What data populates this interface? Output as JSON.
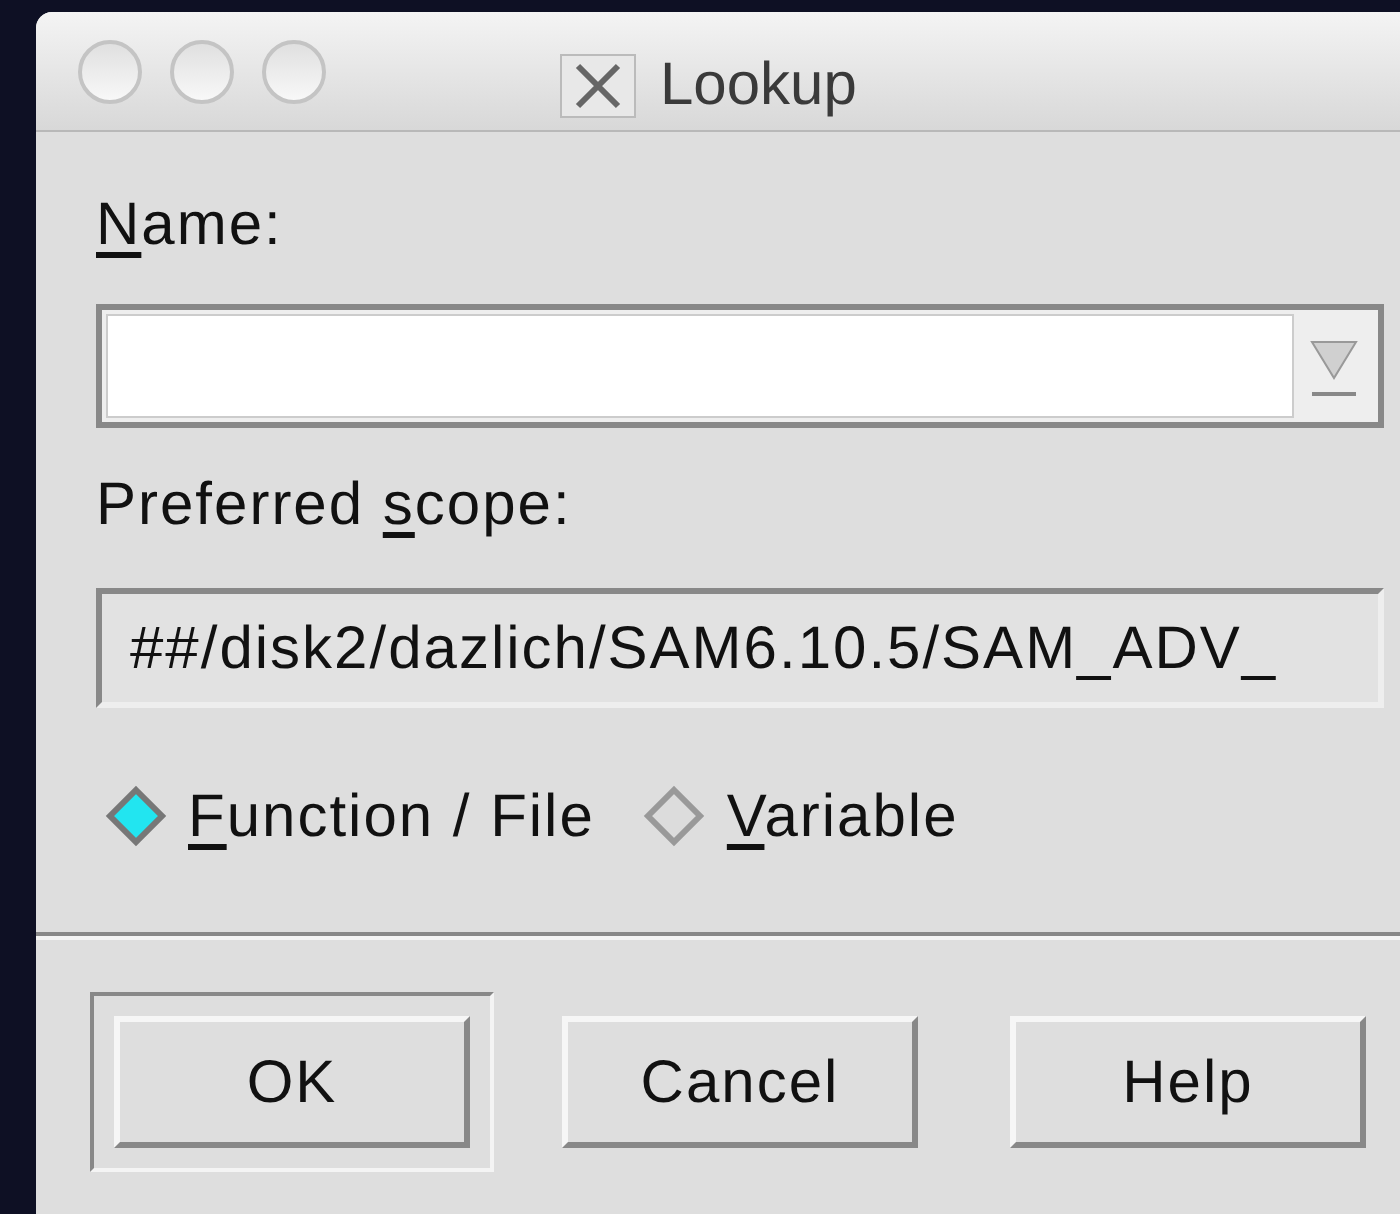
{
  "window": {
    "title": "Lookup"
  },
  "name_field": {
    "accel": "N",
    "label_rest": "ame:"
  },
  "scope_field": {
    "label_start": "Preferred ",
    "accel": "s",
    "label_rest": "cope:",
    "value": "##/disk2/dazlich/SAM6.10.5/SAM_ADV_"
  },
  "search_type": [
    {
      "accel": "F",
      "label_rest": "unction / File",
      "selected": true
    },
    {
      "accel": "V",
      "label_rest": "ariable",
      "selected": false
    }
  ],
  "buttons": [
    {
      "label": "OK",
      "default": true
    },
    {
      "label": "Cancel",
      "default": false
    },
    {
      "label": "Help",
      "default": false
    }
  ]
}
